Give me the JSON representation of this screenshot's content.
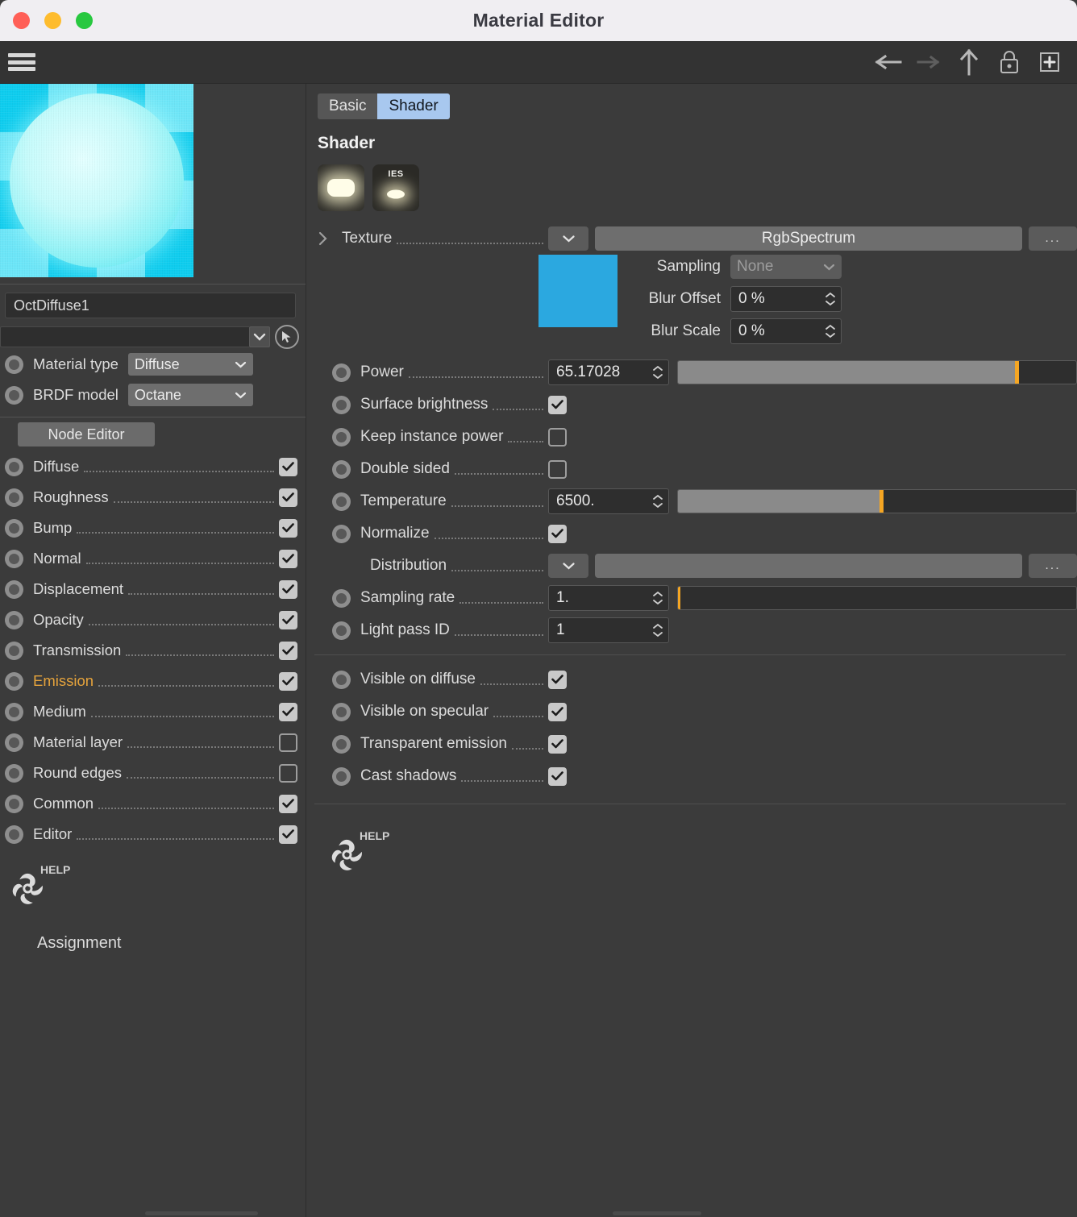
{
  "window": {
    "title": "Material Editor"
  },
  "titlebar": {
    "close": "close",
    "minimize": "minimize",
    "zoom": "zoom"
  },
  "toolbar": {
    "menu_label": "menu",
    "back_label": "back",
    "forward_label": "forward",
    "up_label": "up",
    "lock_label": "lock",
    "add_label": "add"
  },
  "left": {
    "material_name": "OctDiffuse1",
    "picker_value": "",
    "material_type": {
      "label": "Material type",
      "value": "Diffuse"
    },
    "brdf_model": {
      "label": "BRDF model",
      "value": "Octane"
    },
    "node_editor_button": "Node Editor",
    "channels": [
      {
        "label": "Diffuse",
        "checked": true,
        "accent": false
      },
      {
        "label": "Roughness",
        "checked": true,
        "accent": false
      },
      {
        "label": "Bump",
        "checked": true,
        "accent": false
      },
      {
        "label": "Normal",
        "checked": true,
        "accent": false
      },
      {
        "label": "Displacement",
        "checked": true,
        "accent": false
      },
      {
        "label": "Opacity",
        "checked": true,
        "accent": false
      },
      {
        "label": "Transmission",
        "checked": true,
        "accent": false
      },
      {
        "label": "Emission",
        "checked": true,
        "accent": true
      },
      {
        "label": "Medium",
        "checked": true,
        "accent": false
      },
      {
        "label": "Material layer",
        "checked": false,
        "accent": false
      },
      {
        "label": "Round edges",
        "checked": false,
        "accent": false
      },
      {
        "label": "Common",
        "checked": true,
        "accent": false
      },
      {
        "label": "Editor",
        "checked": true,
        "accent": false
      }
    ],
    "help_label": "HELP",
    "assignment_label": "Assignment"
  },
  "right": {
    "tabs": [
      {
        "label": "Basic",
        "active": false
      },
      {
        "label": "Shader",
        "active": true
      }
    ],
    "section_title": "Shader",
    "shader_thumbs": [
      {
        "name": "light-thumb",
        "badge": ""
      },
      {
        "name": "ies-thumb",
        "badge": "IES"
      }
    ],
    "texture": {
      "label": "Texture",
      "value": "RgbSpectrum",
      "more_label": "...",
      "swatch_color": "#2BA8E0",
      "sampling": {
        "label": "Sampling",
        "value": "None"
      },
      "blur_offset": {
        "label": "Blur Offset",
        "value": "0 %"
      },
      "blur_scale": {
        "label": "Blur Scale",
        "value": "0 %"
      }
    },
    "params": [
      {
        "label": "Power",
        "value": "65.17028",
        "fill_pct": 85,
        "mark_pct": 85
      },
      {
        "label": "Surface brightness",
        "checked": true
      },
      {
        "label": "Keep instance power",
        "checked": false
      },
      {
        "label": "Double sided",
        "checked": false
      },
      {
        "label": "Temperature",
        "value": "6500.",
        "fill_pct": 51,
        "mark_pct": 51
      },
      {
        "label": "Normalize",
        "checked": true
      },
      {
        "label": "Distribution",
        "value": "",
        "more_label": "..."
      },
      {
        "label": "Sampling rate",
        "value": "1.",
        "fill_pct": 0,
        "mark_pct": 0
      },
      {
        "label": "Light pass ID",
        "value": "1"
      }
    ],
    "visibility": [
      {
        "label": "Visible on diffuse",
        "checked": true
      },
      {
        "label": "Visible on specular",
        "checked": true
      },
      {
        "label": "Transparent emission",
        "checked": true
      },
      {
        "label": "Cast shadows",
        "checked": true
      }
    ],
    "help_label": "HELP"
  }
}
